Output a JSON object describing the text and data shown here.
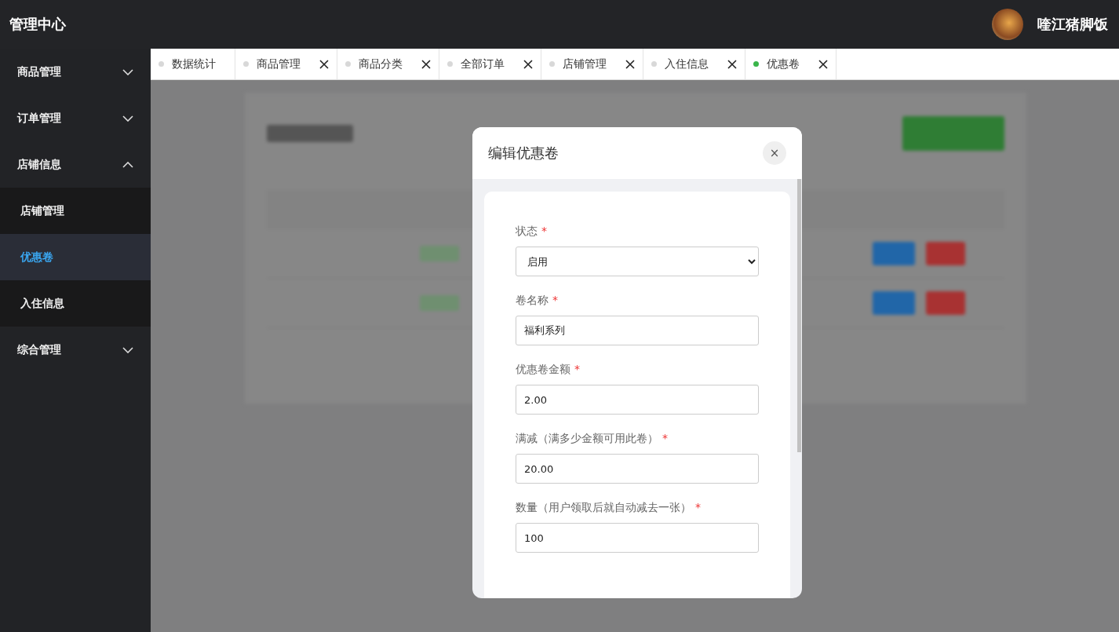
{
  "header": {
    "title": "管理中心",
    "user_name": "喹江猪脚饭"
  },
  "sidebar": {
    "items": [
      {
        "label": "商品管理",
        "expanded": false
      },
      {
        "label": "订单管理",
        "expanded": false
      },
      {
        "label": "店铺信息",
        "expanded": true,
        "children": [
          {
            "label": "店铺管理",
            "selected": false
          },
          {
            "label": "优惠卷",
            "selected": true
          },
          {
            "label": "入住信息",
            "selected": false
          }
        ]
      },
      {
        "label": "综合管理",
        "expanded": false
      }
    ]
  },
  "tabs": [
    {
      "label": "数据统计",
      "selected": false,
      "closable": false
    },
    {
      "label": "商品管理",
      "selected": false,
      "closable": true
    },
    {
      "label": "商品分类",
      "selected": false,
      "closable": true
    },
    {
      "label": "全部订单",
      "selected": false,
      "closable": true
    },
    {
      "label": "店铺管理",
      "selected": false,
      "closable": true
    },
    {
      "label": "入住信息",
      "selected": false,
      "closable": true
    },
    {
      "label": "优惠卷",
      "selected": true,
      "closable": true
    }
  ],
  "dialog": {
    "title": "编辑优惠卷",
    "close": "×",
    "fields": [
      {
        "kind": "select",
        "label": "状态",
        "required_mark": "*",
        "value": "启用"
      },
      {
        "kind": "input",
        "label": "卷名称",
        "required_mark": "*",
        "value": "福利系列"
      },
      {
        "kind": "input",
        "label": "优惠卷金额",
        "required_mark": "*",
        "value": "2.00"
      },
      {
        "kind": "input",
        "label": "满减（满多少金额可用此卷）",
        "required_mark": "*",
        "value": "20.00"
      },
      {
        "kind": "input",
        "label": "数量（用户领取后就自动减去一张）",
        "required_mark": "*",
        "value": "100"
      }
    ]
  }
}
